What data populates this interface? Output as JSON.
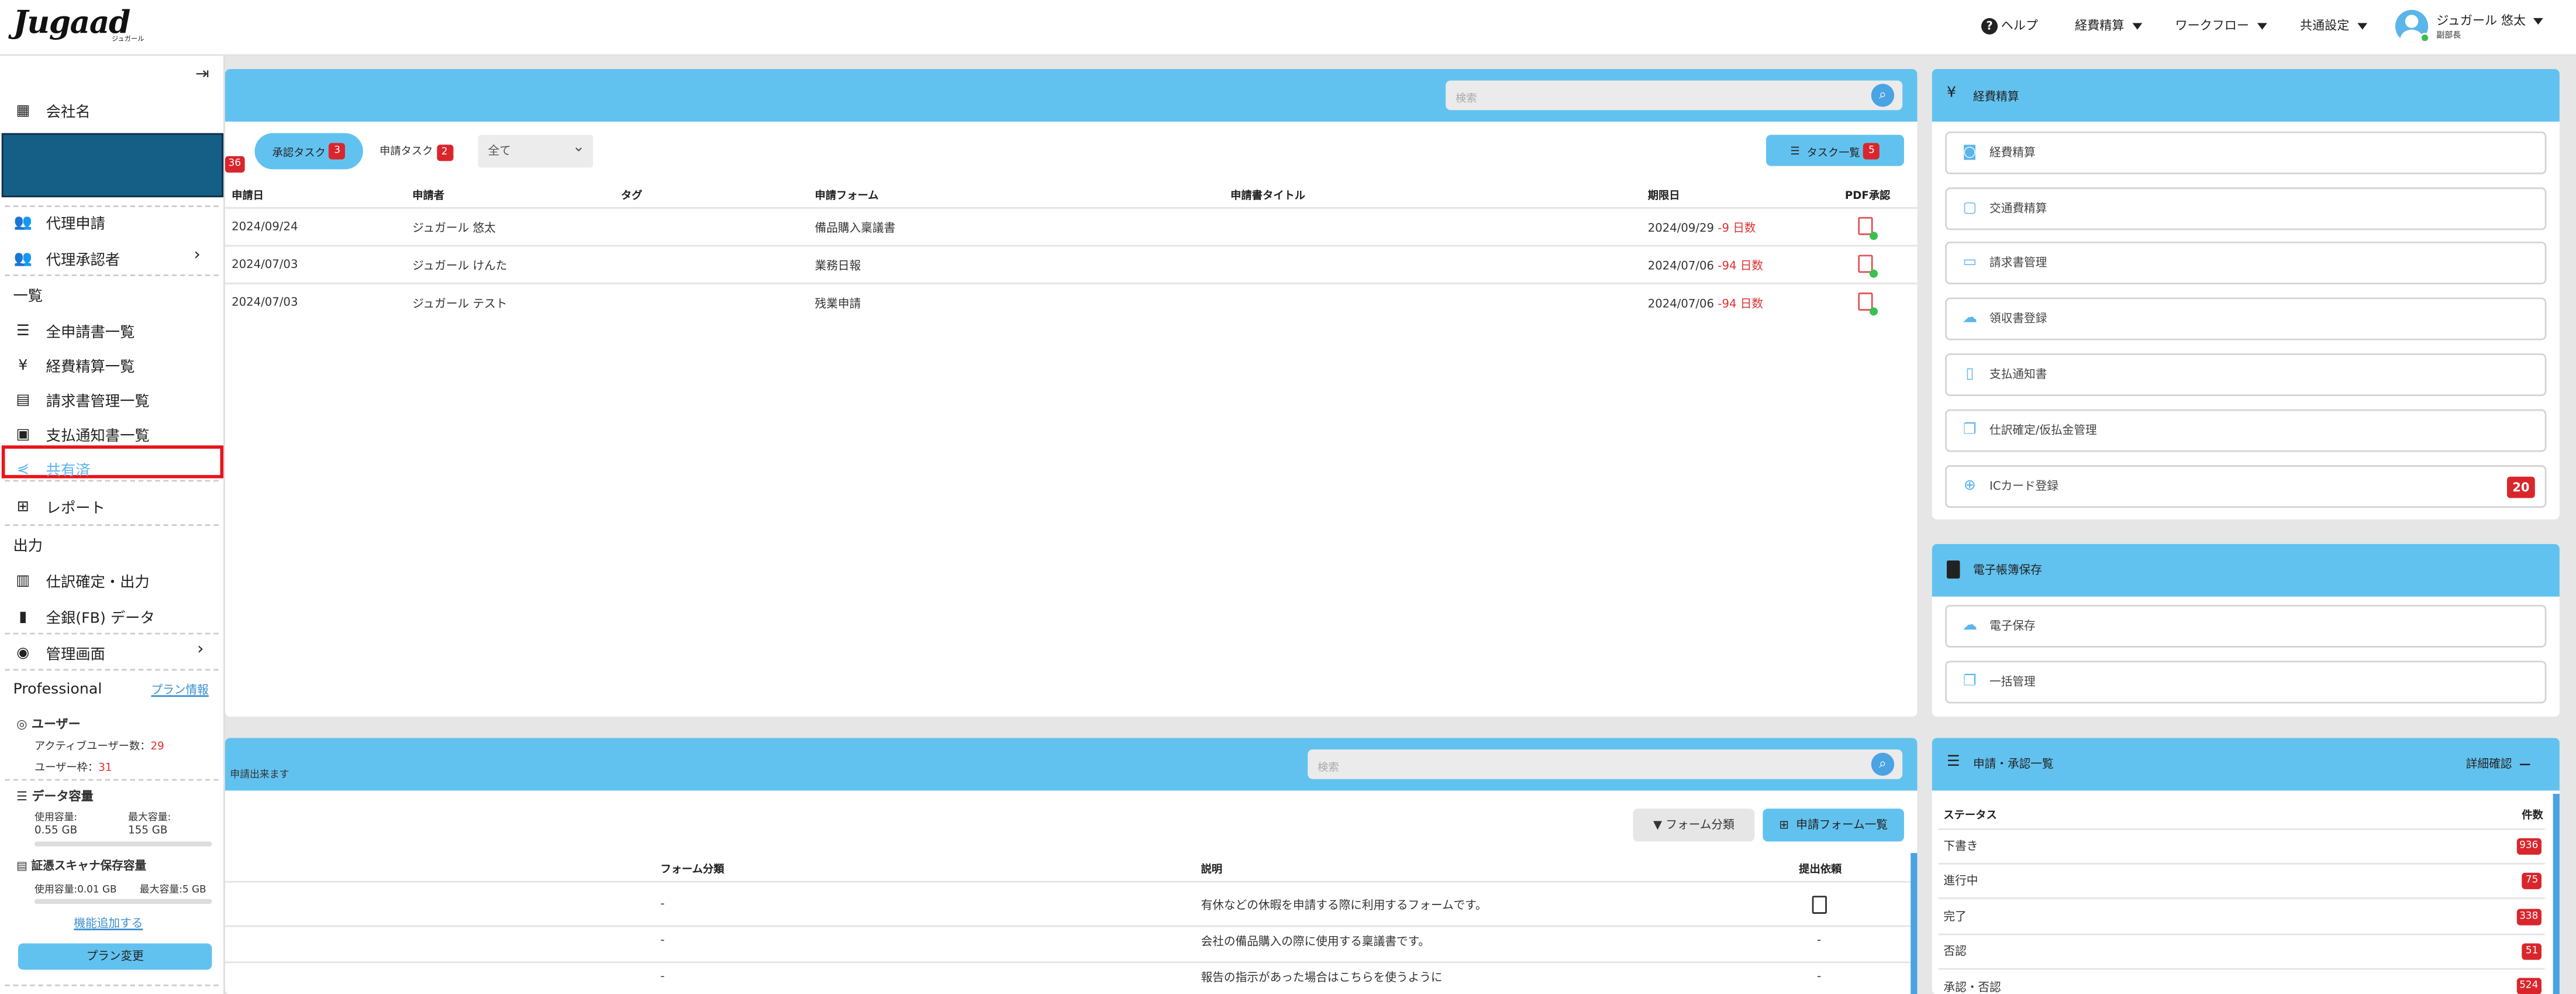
{
  "header": {
    "logo": "Jugaad",
    "logo_sub": "ジュガール",
    "help": "ヘルプ",
    "nav": [
      "経費精算",
      "ワークフロー",
      "共通設定"
    ],
    "user_name": "ジュガール 悠太",
    "user_role": "副部長"
  },
  "sidebar": {
    "company": "会社名",
    "items": [
      {
        "label": "代理申請",
        "icon": "people-icon"
      },
      {
        "label": "代理承認者",
        "icon": "people-icon"
      }
    ],
    "section_list": "一覧",
    "list_items": [
      {
        "label": "全申請書一覧",
        "icon": "list-icon"
      },
      {
        "label": "経費精算一覧",
        "icon": "yen-icon"
      },
      {
        "label": "請求書管理一覧",
        "icon": "invoice-icon"
      },
      {
        "label": "支払通知書一覧",
        "icon": "notice-icon"
      },
      {
        "label": "共有済",
        "icon": "share-icon"
      },
      {
        "label": "レポート",
        "icon": "table-icon"
      }
    ],
    "section_output": "出力",
    "output_items": [
      {
        "label": "仕訳確定・出力",
        "icon": "journal-icon"
      },
      {
        "label": "全銀(FB) データ",
        "icon": "file-icon"
      },
      {
        "label": "管理画面",
        "icon": "admin-icon"
      }
    ],
    "plan": "Professional",
    "plan_link": "プラン情報",
    "user_title": "ユーザー",
    "active_users_label": "アクティブユーザー数：",
    "active_users": "29",
    "user_limit_label": "ユーザー枠：",
    "user_limit": "31",
    "data_title": "データ容量",
    "used_label": "使用容量:",
    "used": "0.55 GB",
    "max_label": "最大容量:",
    "max": "155 GB",
    "scanner_title": "証憑スキャナ保存容量",
    "scan_used": "使用容量:0.01 GB",
    "scan_max": "最大容量:5 GB",
    "add_feature": "機能追加する",
    "plan_change": "プラン変更"
  },
  "tasks": {
    "search_placeholder": "検索",
    "left_badge": "36",
    "approval_tab": "承認タスク",
    "approval_count": "3",
    "apply_tab": "申請タスク",
    "apply_count": "2",
    "filter": "全て",
    "task_list_btn": "タスク一覧",
    "task_list_count": "5",
    "columns": [
      "申請日",
      "申請者",
      "タグ",
      "申請フォーム",
      "申請書タイトル",
      "期限日",
      "PDF承認"
    ],
    "rows": [
      {
        "date": "2024/09/24",
        "applicant": "ジュガール 悠太",
        "form": "備品購入稟議書",
        "due": "2024/09/29",
        "days": "-9 日数"
      },
      {
        "date": "2024/07/03",
        "applicant": "ジュガール けんた",
        "form": "業務日報",
        "due": "2024/07/06",
        "days": "-94 日数"
      },
      {
        "date": "2024/07/03",
        "applicant": "ジュガール テスト",
        "form": "残業申請",
        "due": "2024/07/06",
        "days": "-94 日数"
      }
    ]
  },
  "forms": {
    "subtitle": "申請出来ます",
    "search_placeholder": "検索",
    "category_btn": "フォーム分類",
    "list_btn": "申請フォーム一覧",
    "columns": [
      "フォーム分類",
      "説明",
      "提出依頼"
    ],
    "rows": [
      {
        "category": "-",
        "desc": "有休などの休暇を申請する際に利用するフォームです。",
        "req": ""
      },
      {
        "category": "-",
        "desc": "会社の備品購入の際に使用する稟議書です。",
        "req": "-"
      },
      {
        "category": "-",
        "desc": "報告の指示があった場合はこちらを使うように",
        "req": "-"
      }
    ]
  },
  "expense": {
    "title": "経費精算",
    "items": [
      {
        "label": "経費精算",
        "icon": "camera-icon"
      },
      {
        "label": "交通費精算",
        "icon": "train-icon"
      },
      {
        "label": "請求書管理",
        "icon": "card-icon"
      },
      {
        "label": "領収書登録",
        "icon": "cloud-upload-icon"
      },
      {
        "label": "支払通知書",
        "icon": "receipt-icon"
      },
      {
        "label": "仕訳確定/仮払金管理",
        "icon": "copy-icon"
      },
      {
        "label": "ICカード登録",
        "icon": "globe-icon",
        "badge": "20"
      }
    ]
  },
  "ebook": {
    "title": "電子帳簿保存",
    "items": [
      {
        "label": "電子保存",
        "icon": "cloud-upload-icon"
      },
      {
        "label": "一括管理",
        "icon": "copy-icon"
      }
    ]
  },
  "status": {
    "title": "申請・承認一覧",
    "detail": "詳細確認",
    "col_status": "ステータス",
    "col_count": "件数",
    "rows": [
      {
        "label": "下書き",
        "count": "936"
      },
      {
        "label": "進行中",
        "count": "75"
      },
      {
        "label": "完了",
        "count": "338"
      },
      {
        "label": "否認",
        "count": "51"
      },
      {
        "label": "承認・否認",
        "count": "524"
      }
    ]
  },
  "colors": {
    "accent": "#62c2ef",
    "badge": "#d9262c",
    "highlight": "#e8141b",
    "sidebar_block": "#155e85"
  }
}
